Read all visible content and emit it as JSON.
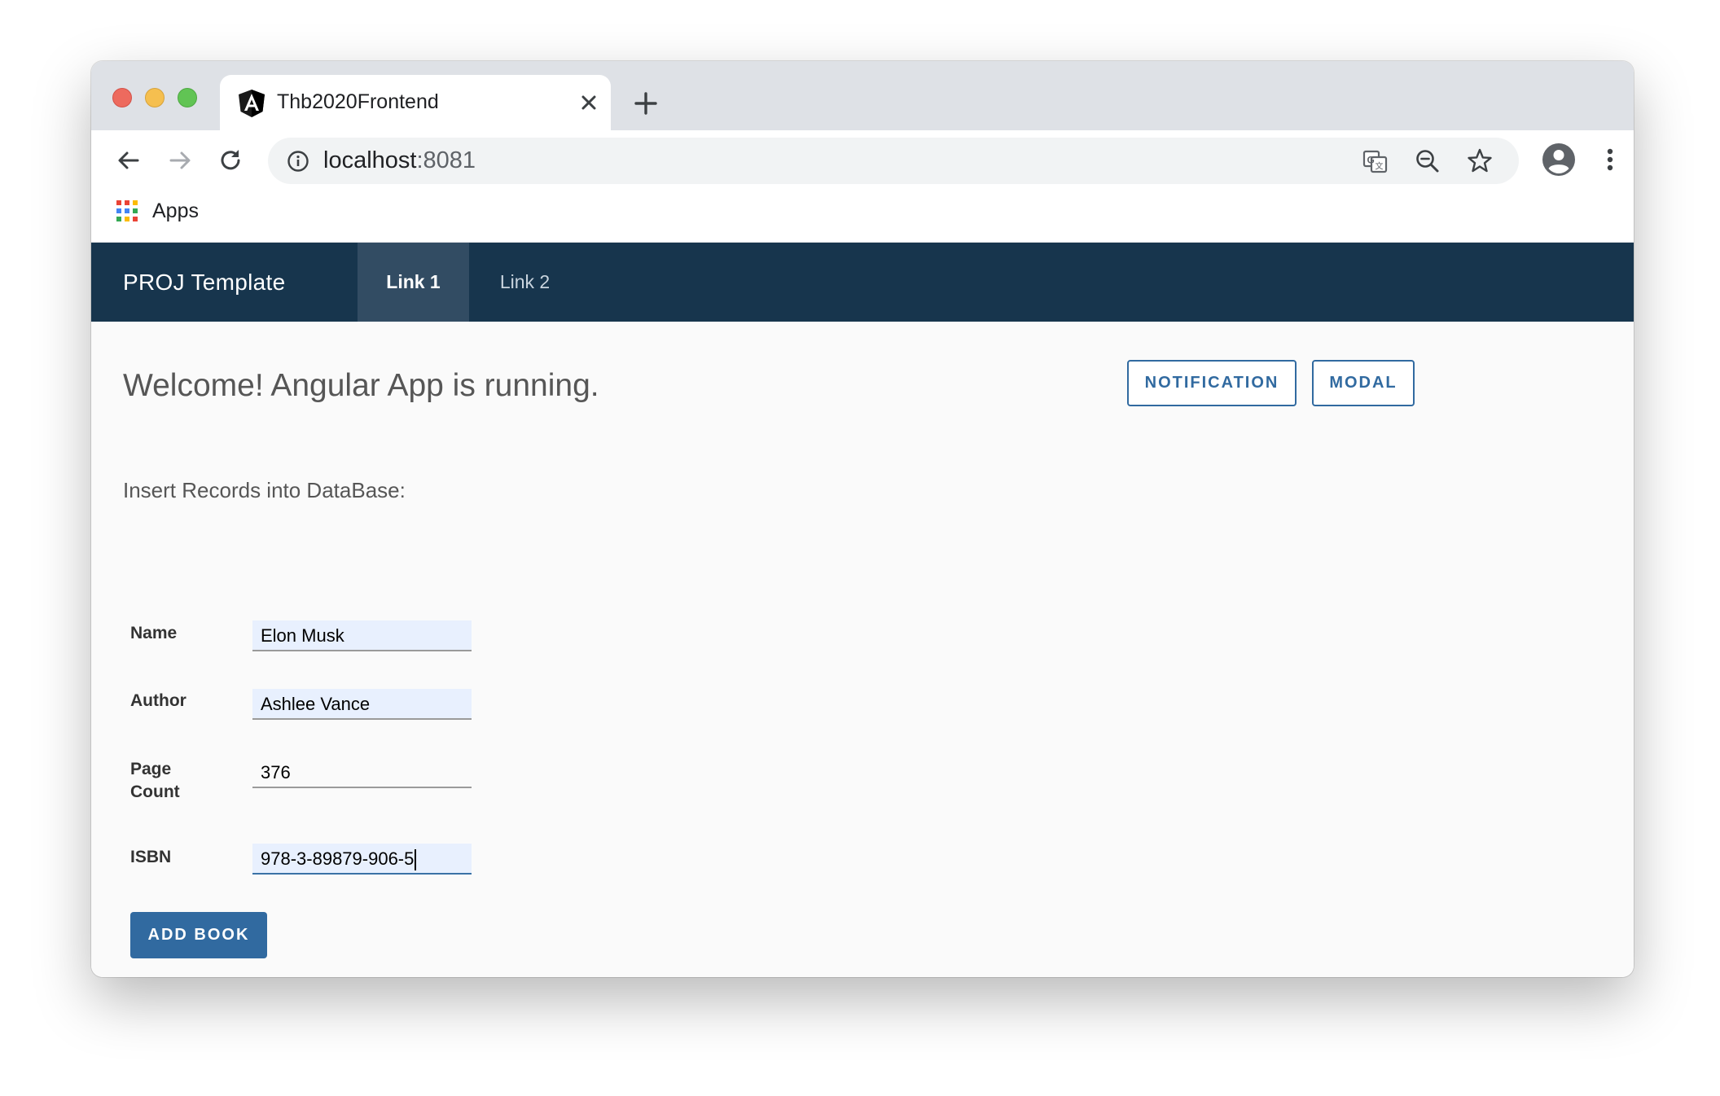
{
  "browser": {
    "tab_title": "Thb2020Frontend",
    "url_host": "localhost",
    "url_port": ":8081",
    "bookmarks": {
      "apps_label": "Apps"
    }
  },
  "app": {
    "brand": "PROJ Template",
    "nav": [
      {
        "label": "Link 1",
        "active": true
      },
      {
        "label": "Link 2",
        "active": false
      }
    ],
    "welcome": "Welcome! Angular App is running.",
    "buttons": {
      "notification": "NOTIFICATION",
      "modal": "MODAL"
    },
    "subtitle": "Insert Records into DataBase:",
    "form": {
      "name_label": "Name",
      "name_value": "Elon Musk",
      "author_label": "Author",
      "author_value": "Ashlee Vance",
      "page_label_line1": "Page",
      "page_label_line2": "Count",
      "page_value": "376",
      "isbn_label": "ISBN",
      "isbn_value": "978-3-89879-906-5",
      "submit_label": "ADD BOOK"
    }
  },
  "colors": {
    "header_bg": "#17354d",
    "active_nav_bg": "#324c63",
    "accent": "#316aa0",
    "autofill_bg": "#e8f0fe"
  }
}
